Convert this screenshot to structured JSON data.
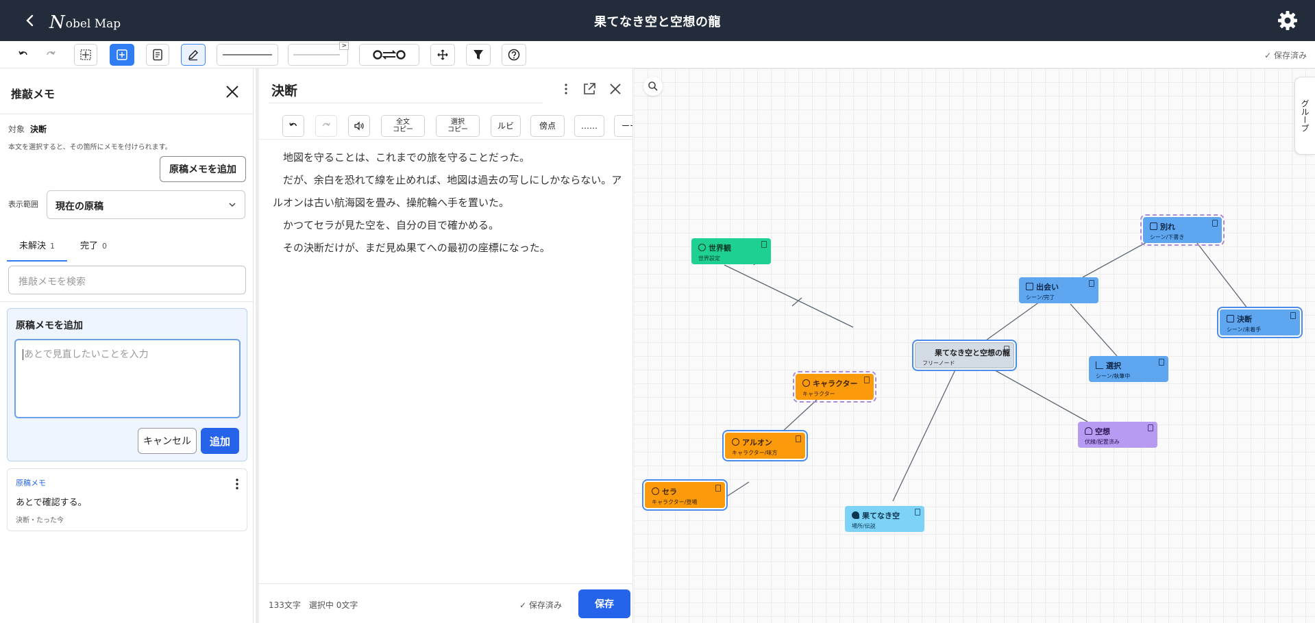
{
  "header": {
    "back_icon": "chevron-left-icon",
    "logo_initial": "N",
    "logo_rest": "obel Map",
    "title": "果てなき空と空想の龍",
    "settings_icon": "gear-icon"
  },
  "toolbar": {
    "saved_status": "保存済み",
    "buttons": [
      "undo-icon",
      "redo-icon",
      "grid-layout-icon",
      "add-node-icon",
      "document-icon",
      "pen-icon",
      "line-solid-icon",
      "line-dashed-icon",
      "link-toggle-icon",
      "move-icon",
      "filter-icon",
      "help-icon"
    ]
  },
  "memo_panel": {
    "title": "推敲メモ",
    "target_label": "対象",
    "target_value": "決断",
    "hint": "本文を選択すると、その箇所にメモを付けられます。",
    "add_manuscript_memo_button": "原稿メモを追加",
    "range_label": "表示範囲",
    "range_value": "現在の原稿",
    "tabs": [
      {
        "label": "未解決",
        "count": "1"
      },
      {
        "label": "完了",
        "count": "0"
      }
    ],
    "search_placeholder": "推敲メモを検索",
    "new_memo": {
      "heading": "原稿メモを追加",
      "placeholder": "あとで見直したいことを入力",
      "cancel_label": "キャンセル",
      "add_label": "追加"
    },
    "memo": {
      "type": "原稿メモ",
      "body": "あとで確認する。",
      "meta": "決断・たった今"
    }
  },
  "editor": {
    "title": "決断",
    "tools": {
      "full_copy_top": "全文",
      "full_copy_bottom": "コピー",
      "select_copy_top": "選択",
      "select_copy_bottom": "コピー",
      "ruby": "ルビ",
      "emphasis": "傍点",
      "ellipsis": "……",
      "dash": "ーー"
    },
    "paragraphs": [
      "地図を守ることは、これまでの旅を守ることだった。",
      "だが、余白を恐れて線を止めれば、地図は過去の写しにしかならない。アルオンは古い航海図を畳み、操舵輪へ手を置いた。",
      "かつてセラが見た空を、自分の目で確かめる。",
      "その決断だけが、まだ見ぬ果てへの最初の座標になった。"
    ],
    "char_count": "133文字",
    "selection_count": "選択中 0文字",
    "saved_status": "保存済み",
    "save_label": "保存"
  },
  "map": {
    "group_tab": "グループ",
    "nodes": [
      {
        "id": "center",
        "title": "果てなき空と空想の龍",
        "subtitle": "フリーノード",
        "color": "#d3dbe4"
      },
      {
        "id": "worldview",
        "title": "世界観",
        "subtitle": "世界設定",
        "color": "#1ed192"
      },
      {
        "id": "character",
        "title": "キャラクター",
        "subtitle": "キャラクター",
        "color": "#fb9a0b"
      },
      {
        "id": "arion",
        "title": "アルオン",
        "subtitle": "キャラクター/味方",
        "color": "#fb9a0b"
      },
      {
        "id": "sera",
        "title": "セラ",
        "subtitle": "キャラクター/登場",
        "color": "#fb9a0b"
      },
      {
        "id": "hatenakisora",
        "title": "果てなき空",
        "subtitle": "場所/伝説",
        "color": "#7dd3f7"
      },
      {
        "id": "kuusou",
        "title": "空想",
        "subtitle": "伏線/配置済み",
        "color": "#b79af2"
      },
      {
        "id": "deai",
        "title": "出会い",
        "subtitle": "シーン/完了",
        "color": "#5ea6f0"
      },
      {
        "id": "sentaku",
        "title": "選択",
        "subtitle": "シーン/執筆中",
        "color": "#5ea6f0"
      },
      {
        "id": "wakare",
        "title": "別れ",
        "subtitle": "シーン/下書き",
        "color": "#5ea6f0"
      },
      {
        "id": "ketsudan",
        "title": "決断",
        "subtitle": "シーン/未着手",
        "color": "#5ea6f0"
      }
    ]
  }
}
